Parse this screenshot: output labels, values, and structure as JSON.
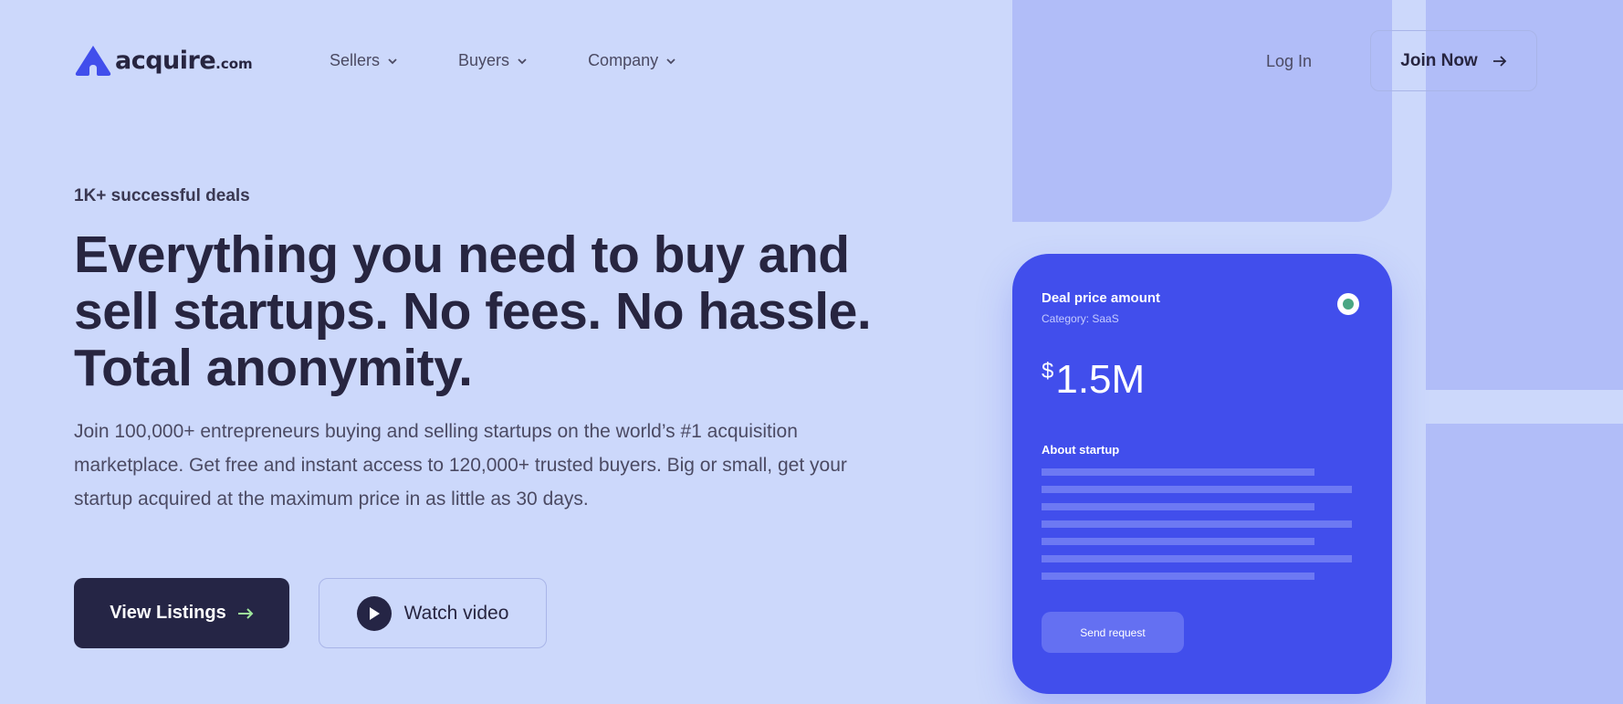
{
  "header": {
    "logo": {
      "word": "acquire",
      "tld": ".com"
    },
    "nav": [
      {
        "label": "Sellers"
      },
      {
        "label": "Buyers"
      },
      {
        "label": "Company"
      }
    ],
    "login_label": "Log In",
    "join_label": "Join Now"
  },
  "hero": {
    "kicker": "1K+ successful deals",
    "headline": "Everything you need to buy and sell startups. No fees. No hassle. Total anonymity.",
    "subtext": "Join 100,000+ entrepreneurs buying and selling startups on the world’s #1 acquisition marketplace. Get free and instant access to 120,000+ trusted buyers. Big or small, get your startup acquired at the maximum price in as little as 30 days.",
    "primary_cta": "View Listings",
    "secondary_cta": "Watch video"
  },
  "card": {
    "title": "Deal price amount",
    "category": "Category: SaaS",
    "currency": "$",
    "amount": "1.5M",
    "about_label": "About startup",
    "send_label": "Send request"
  },
  "colors": {
    "background": "#ccd8fb",
    "accent": "#414eec",
    "dark": "#252545",
    "status": "#4aa683",
    "arrow_accent": "#9ee59b"
  }
}
